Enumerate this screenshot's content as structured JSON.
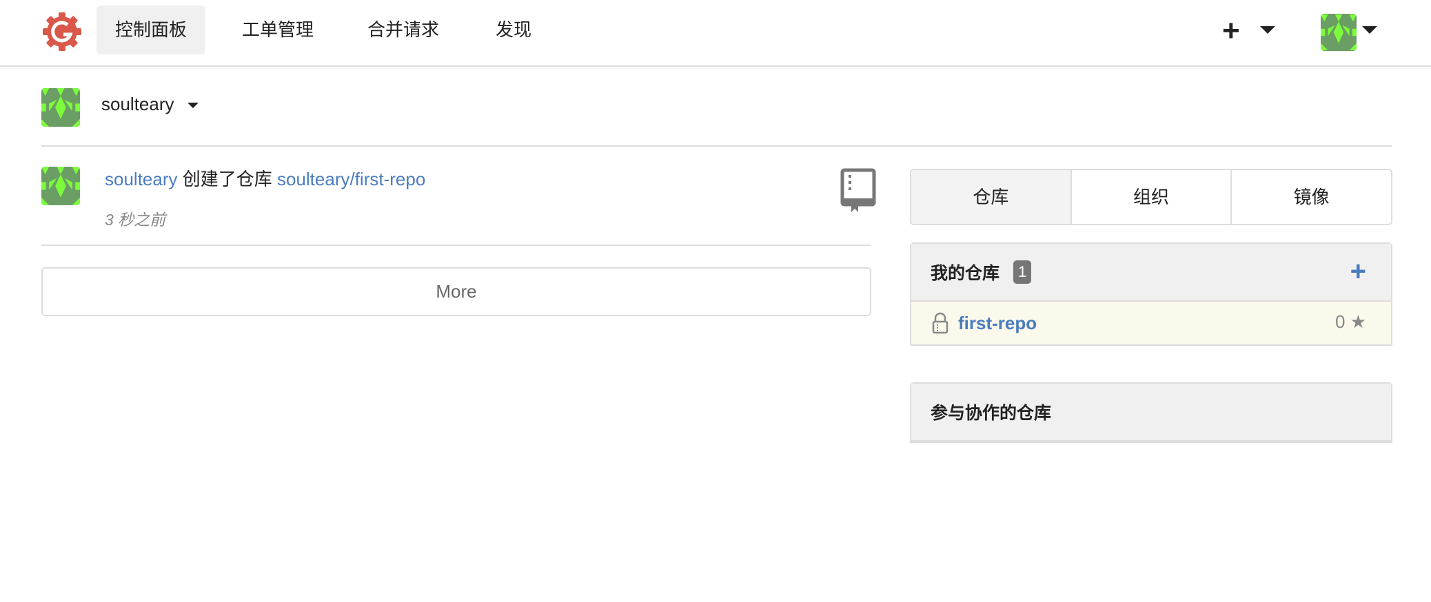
{
  "nav": {
    "items": [
      {
        "label": "控制面板",
        "active": true
      },
      {
        "label": "工单管理"
      },
      {
        "label": "合并请求"
      },
      {
        "label": "发现"
      }
    ],
    "create_label": "+"
  },
  "user": {
    "name": "soulteary"
  },
  "feed": {
    "actor": "soulteary",
    "action": "创建了仓库",
    "repo": "soulteary/first-repo",
    "time": "3 秒之前",
    "more_label": "More"
  },
  "sidebar": {
    "tabs": [
      "仓库",
      "组织",
      "镜像"
    ],
    "my_repos": {
      "title": "我的仓库",
      "count": "1",
      "repos": [
        {
          "name": "first-repo",
          "stars": "0",
          "private": true
        }
      ]
    },
    "collab_repos": {
      "title": "参与协作的仓库"
    }
  },
  "colors": {
    "link": "#4a7dbf",
    "logo": "#d9584a",
    "avatar_bg": "#6b9e64",
    "avatar_fg": "#7dfc3c"
  }
}
